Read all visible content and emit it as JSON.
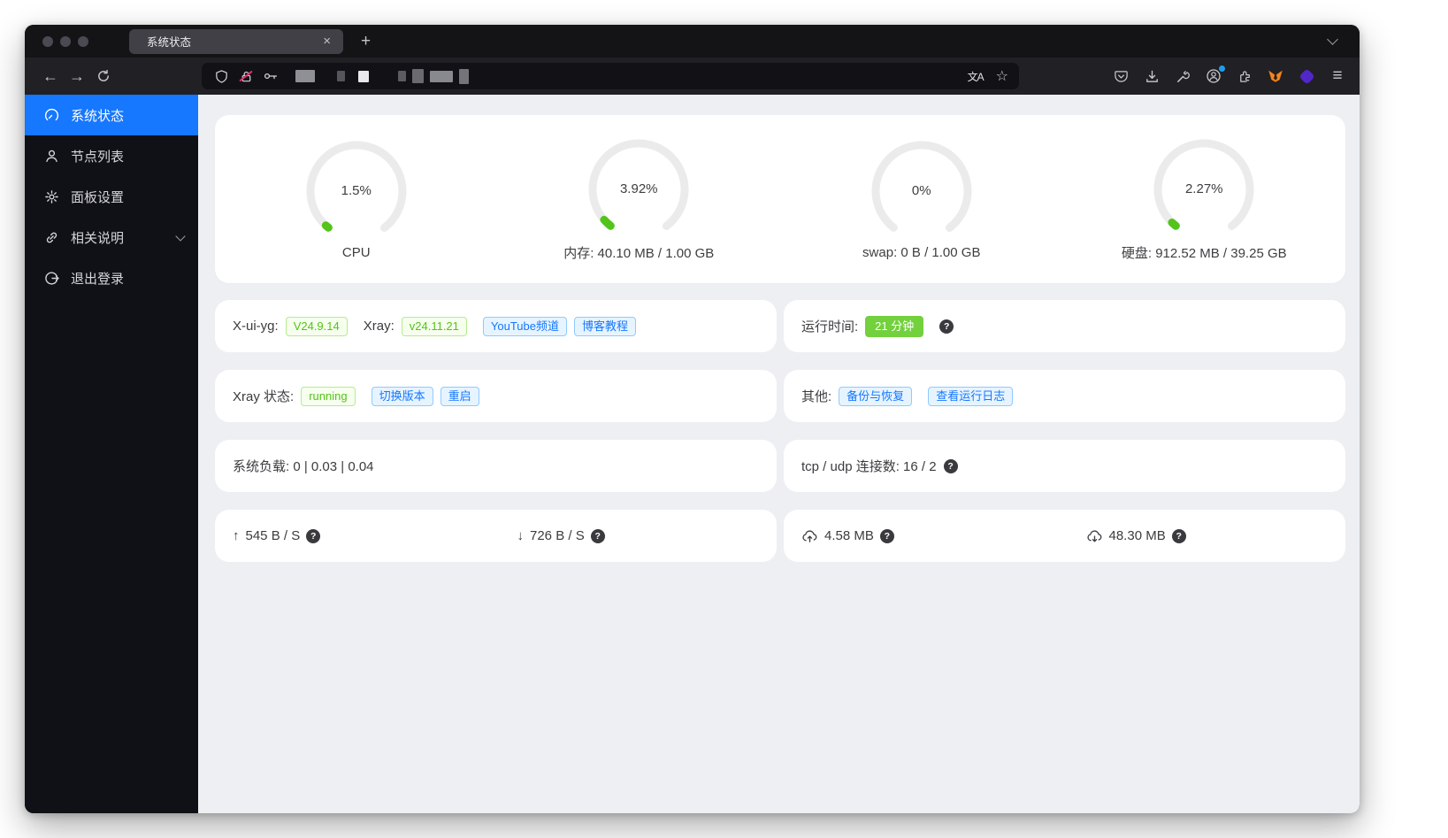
{
  "colors": {
    "accent": "#1677ff",
    "success_green": "#52c41a",
    "uptime_tag_bg": "#73d13d",
    "tag_green_bg": "#f6ffed",
    "tag_green_border": "#b7eb8f",
    "tag_blue_bg": "#e6f4ff",
    "tag_blue_border": "#91caff",
    "gauge_track": "#ebebeb",
    "sidebar_bg": "#101116",
    "main_bg": "#edeff3",
    "metamask_orange": "#f6851b",
    "wallet_purple": "#5127c8"
  },
  "glyphs": {
    "back": "←",
    "forward": "→",
    "close": "×",
    "new_tab": "+",
    "bookmark_star": "☆",
    "menu": "≡",
    "translate": "文A",
    "help": "?",
    "net_up": "↑",
    "net_down": "↓"
  },
  "browser": {
    "tab_title": "系统状态"
  },
  "sidebar": {
    "items": [
      {
        "label": "系统状态",
        "active": true
      },
      {
        "label": "节点列表"
      },
      {
        "label": "面板设置"
      },
      {
        "label": "相关说明",
        "has_submenu": true
      },
      {
        "label": "退出登录"
      }
    ]
  },
  "gauges": [
    {
      "value": "1.5%",
      "label": "CPU",
      "percent": 1.5
    },
    {
      "value": "3.92%",
      "label": "内存: 40.10 MB / 1.00 GB",
      "percent": 3.92
    },
    {
      "value": "0%",
      "label": "swap: 0 B / 1.00 GB",
      "percent": 0
    },
    {
      "value": "2.27%",
      "label": "硬盘: 912.52 MB / 39.25 GB",
      "percent": 2.27
    }
  ],
  "rows": {
    "version": {
      "xui_label": "X-ui-yg:",
      "xui_version": "V24.9.14",
      "xray_label": "Xray:",
      "xray_version": "v24.11.21",
      "link_tags": [
        "YouTube频道",
        "博客教程"
      ]
    },
    "uptime": {
      "label": "运行时间:",
      "value": "21 分钟"
    },
    "xray_status": {
      "label": "Xray 状态:",
      "status": "running",
      "action_tags": [
        "切换版本",
        "重启"
      ]
    },
    "other": {
      "label": "其他:",
      "action_tags": [
        "备份与恢复",
        "查看运行日志"
      ]
    },
    "system_load": {
      "text": "系统负载: 0 | 0.03 | 0.04"
    },
    "connections": {
      "text": "tcp / udp 连接数: 16 / 2"
    },
    "net_speed": {
      "up": "545 B / S",
      "down": "726 B / S"
    },
    "net_total": {
      "up": "4.58 MB",
      "down": "48.30 MB"
    }
  }
}
